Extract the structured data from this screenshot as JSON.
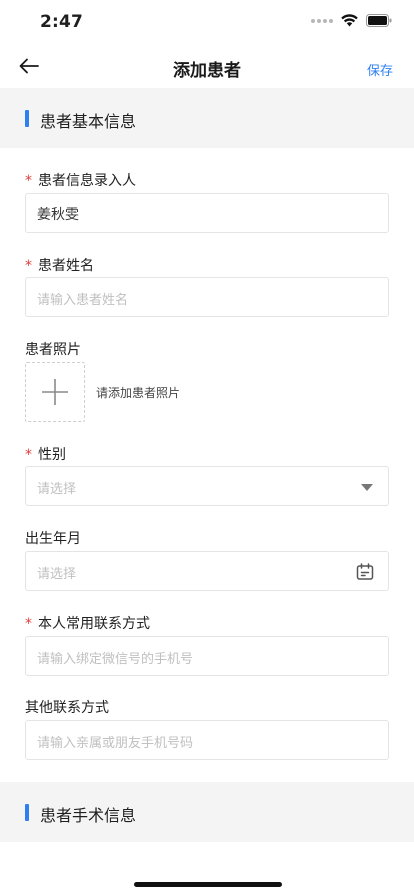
{
  "status_bar": {
    "time": "2:47"
  },
  "nav": {
    "title": "添加患者",
    "save_label": "保存"
  },
  "sections": {
    "basic_info": "患者基本信息",
    "surgery_info": "患者手术信息"
  },
  "fields": {
    "recorder": {
      "required_mark": "*",
      "label": "患者信息录入人",
      "value": "姜秋雯"
    },
    "name": {
      "required_mark": "*",
      "label": "患者姓名",
      "placeholder": "请输入患者姓名"
    },
    "photo": {
      "label": "患者照片",
      "hint": "请添加患者照片"
    },
    "gender": {
      "required_mark": "*",
      "label": "性别",
      "placeholder": "请选择"
    },
    "birth": {
      "label": "出生年月",
      "placeholder": "请选择"
    },
    "phone": {
      "required_mark": "*",
      "label": "本人常用联系方式",
      "placeholder": "请输入绑定微信号的手机号"
    },
    "other_contact": {
      "label": "其他联系方式",
      "placeholder": "请输入亲属或朋友手机号码"
    }
  },
  "colors": {
    "accent": "#2f7ff2",
    "required": "#e23b3b",
    "section_bg": "#f4f4f4",
    "placeholder": "#c0c0c0"
  },
  "icons": {
    "back": "arrow-left-icon",
    "add_photo": "plus-icon",
    "dropdown": "caret-down-icon",
    "date": "calendar-icon"
  }
}
